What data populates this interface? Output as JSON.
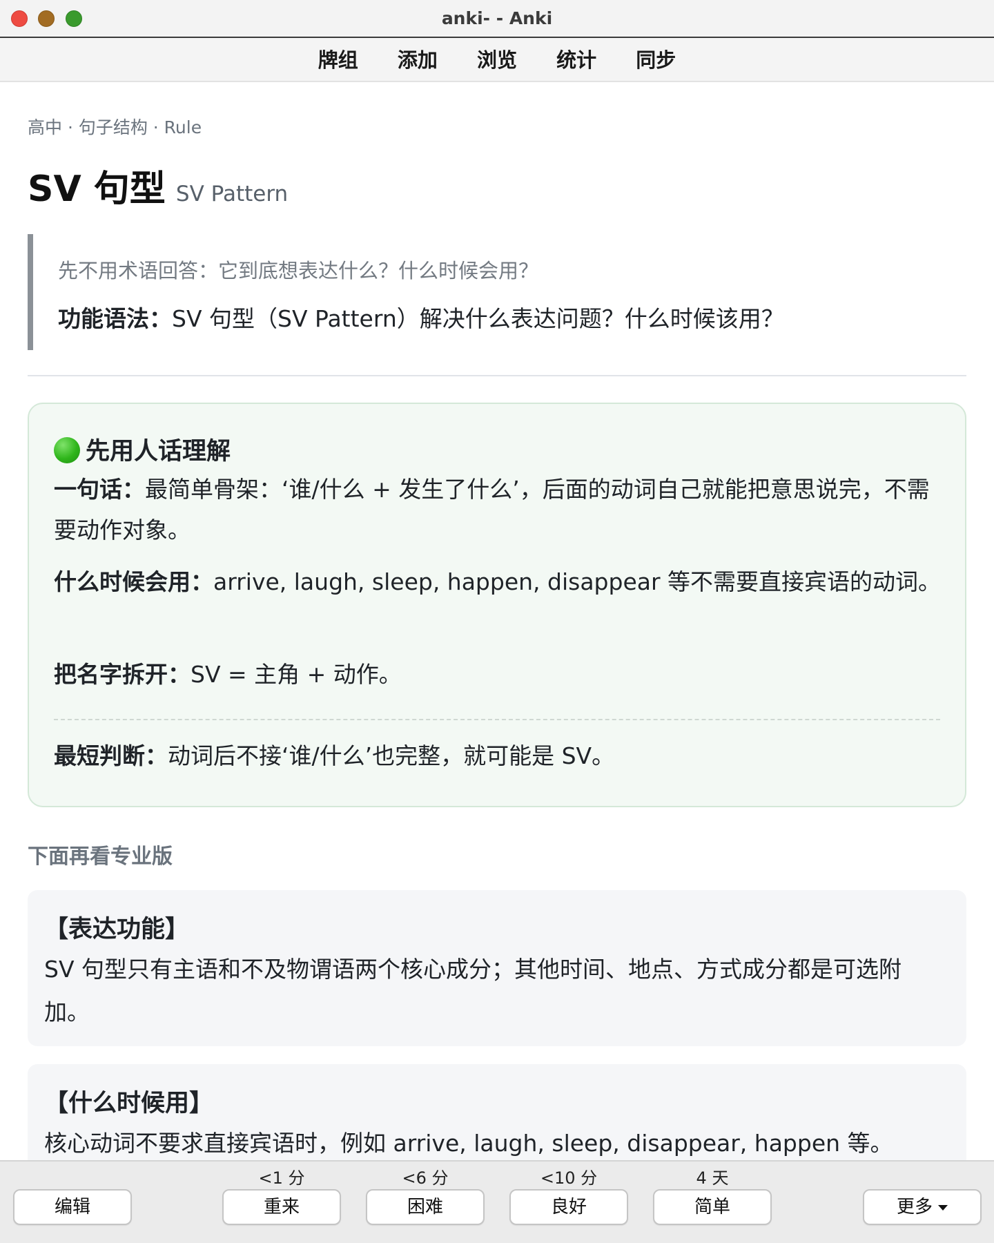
{
  "window": {
    "title": "anki- - Anki"
  },
  "toolbar": {
    "items": [
      "牌组",
      "添加",
      "浏览",
      "统计",
      "同步"
    ]
  },
  "card": {
    "breadcrumb": "高中 · 句子结构 · Rule",
    "title": "SV 句型",
    "subtitle": "SV Pattern",
    "prompt": {
      "hint": "先不用术语回答：它到底想表达什么？什么时候会用？",
      "label": "功能语法：",
      "question": "SV 句型（SV Pattern）解决什么表达问题？什么时候该用？"
    },
    "plain": {
      "title": "先用人话理解",
      "one_line_label": "一句话：",
      "one_line": "最简单骨架：‘谁/什么 + 发生了什么’，后面的动词自己就能把意思说完，不需要动作对象。",
      "when_label": "什么时候会用：",
      "when": "arrive, laugh, sleep, happen, disappear 等不需要直接宾语的动词。",
      "split_label": "把名字拆开：",
      "split": "SV = 主角 + 动作。",
      "quick_label": "最短判断：",
      "quick": "动词后不接‘谁/什么’也完整，就可能是 SV。"
    },
    "pro_title": "下面再看专业版",
    "function_section": {
      "title": "【表达功能】",
      "body": "SV 句型只有主语和不及物谓语两个核心成分；其他时间、地点、方式成分都是可选附加。"
    },
    "when_section": {
      "title": "【什么时候用】",
      "body": "核心动词不要求直接宾语时，例如 arrive, laugh, sleep, disappear, happen 等。"
    }
  },
  "answer_bar": {
    "edit": "编辑",
    "more": "更多",
    "buttons": [
      {
        "time": "<1 分",
        "label": "重来"
      },
      {
        "time": "<6 分",
        "label": "困难"
      },
      {
        "time": "<10 分",
        "label": "良好"
      },
      {
        "time": "4 天",
        "label": "简单"
      }
    ]
  }
}
